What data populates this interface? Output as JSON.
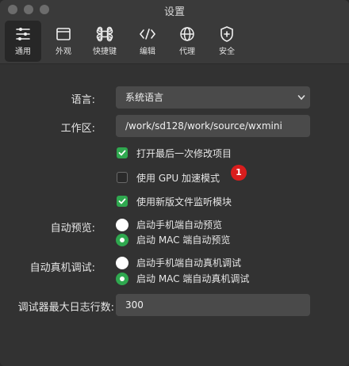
{
  "window": {
    "title": "设置"
  },
  "toolbar": {
    "tabs": [
      {
        "label": "通用",
        "icon": "sliders-icon",
        "active": true
      },
      {
        "label": "外观",
        "icon": "window-icon",
        "active": false
      },
      {
        "label": "快捷键",
        "icon": "command-icon",
        "active": false
      },
      {
        "label": "编辑",
        "icon": "code-icon",
        "active": false
      },
      {
        "label": "代理",
        "icon": "globe-icon",
        "active": false
      },
      {
        "label": "安全",
        "icon": "shield-icon",
        "active": false
      }
    ]
  },
  "general": {
    "language": {
      "label": "语言:",
      "value": "系统语言"
    },
    "workspace": {
      "label": "工作区:",
      "value": "/work/sd128/work/source/wxmini"
    },
    "checkboxes": [
      {
        "label": "打开最后一次修改项目",
        "checked": true
      },
      {
        "label": "使用 GPU 加速模式",
        "checked": false,
        "badge": "1"
      },
      {
        "label": "使用新版文件监听模块",
        "checked": true
      }
    ],
    "auto_preview": {
      "label": "自动预览:",
      "options": [
        {
          "label": "启动手机端自动预览",
          "selected": false
        },
        {
          "label": "启动 MAC 端自动预览",
          "selected": true
        }
      ]
    },
    "auto_debug": {
      "label": "自动真机调试:",
      "options": [
        {
          "label": "启动手机端自动真机调试",
          "selected": false
        },
        {
          "label": "启动 MAC 端自动真机调试",
          "selected": true
        }
      ]
    },
    "max_log": {
      "label": "调试器最大日志行数:",
      "value": "300"
    }
  },
  "colors": {
    "accent": "#2fa84f",
    "badge": "#d91d1d",
    "background": "#323232",
    "field": "#4a4a4a"
  }
}
